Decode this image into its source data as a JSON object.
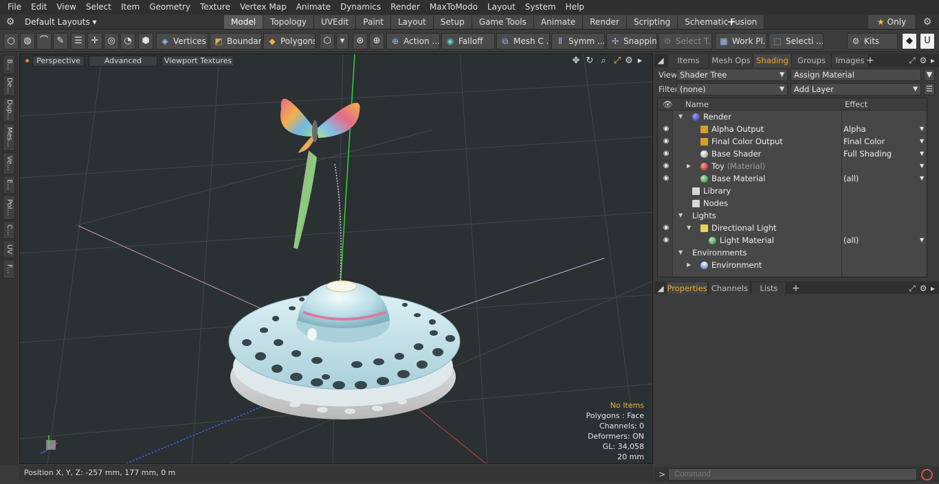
{
  "menu": [
    "File",
    "Edit",
    "View",
    "Select",
    "Item",
    "Geometry",
    "Texture",
    "Vertex Map",
    "Animate",
    "Dynamics",
    "Render",
    "MaxToModo",
    "Layout",
    "System",
    "Help"
  ],
  "layout_select": "Default Layouts ▾",
  "mode_tabs": [
    {
      "label": "Model",
      "active": true
    },
    {
      "label": "Topology"
    },
    {
      "label": "UVEdit"
    },
    {
      "label": "Paint"
    },
    {
      "label": "Layout"
    },
    {
      "label": "Setup"
    },
    {
      "label": "Game Tools"
    },
    {
      "label": "Animate"
    },
    {
      "label": "Render"
    },
    {
      "label": "Scripting"
    },
    {
      "label": "Schematic Fusion"
    }
  ],
  "add_tab": "+",
  "only_label": "Only",
  "toolbar": {
    "vertices": "Vertices",
    "boundary": "Boundary",
    "polygons": "Polygons",
    "action": "Action",
    "falloff": "Falloff",
    "mesh": "Mesh C ...",
    "symmetry": "Symm ...",
    "snapping": "Snapping",
    "select_t": "Select T...",
    "work_plane": "Work Pl...",
    "selection": "Selecti ...",
    "kits": "Kits"
  },
  "left_tabs": [
    "B...",
    "De...",
    "Dup...",
    "Mes...",
    "Ve...",
    "E...",
    "Pol...",
    "C...",
    "UV",
    "F..."
  ],
  "viewport": {
    "view_mode": "Perspective",
    "advanced": "Advanced",
    "textures": "Viewport Textures",
    "info": {
      "selection": "No Items",
      "polygons": "Polygons : Face",
      "channels": "Channels: 0",
      "deformers": "Deformers: ON",
      "gl": "GL: 34,058",
      "grid": "20 mm"
    }
  },
  "status": "Position X, Y, Z:   -257 mm, 177 mm, 0 m",
  "top_panel_tabs": [
    {
      "label": "Items"
    },
    {
      "label": "Mesh Ops"
    },
    {
      "label": "Shading",
      "active": true
    },
    {
      "label": "Groups"
    },
    {
      "label": "Images"
    }
  ],
  "shading": {
    "view_label": "View",
    "view_value": "Shader Tree",
    "assign_material": "Assign Material",
    "filter_label": "Filter",
    "filter_value": "(none)",
    "add_layer": "Add Layer",
    "col_name": "Name",
    "col_effect": "Effect",
    "rows": [
      {
        "name": "Render",
        "effect": "",
        "eye": false,
        "expand": "▼"
      },
      {
        "name": "Alpha Output",
        "effect": "Alpha",
        "eye": true
      },
      {
        "name": "Final Color Output",
        "effect": "Final Color",
        "eye": true
      },
      {
        "name": "Base Shader",
        "effect": "Full Shading",
        "eye": true
      },
      {
        "name": "Toy",
        "sub": "(Material)",
        "effect": "",
        "eye": true,
        "expand": "▶"
      },
      {
        "name": "Base Material",
        "effect": "(all)",
        "eye": true
      },
      {
        "name": "Library",
        "effect": "",
        "eye": false
      },
      {
        "name": "Nodes",
        "effect": "",
        "eye": false
      },
      {
        "name": "Lights",
        "effect": "",
        "eye": false,
        "expand": "▼"
      },
      {
        "name": "Directional Light",
        "effect": "",
        "eye": true,
        "expand": "▼"
      },
      {
        "name": "Light Material",
        "effect": "(all)",
        "eye": true
      },
      {
        "name": "Environments",
        "effect": "",
        "eye": false,
        "expand": "▼"
      },
      {
        "name": "Environment",
        "effect": "",
        "eye": false,
        "expand": "▶"
      }
    ]
  },
  "bottom_panel_tabs": [
    {
      "label": "Properties",
      "active": true
    },
    {
      "label": "Channels"
    },
    {
      "label": "Lists"
    }
  ],
  "command": {
    "prompt": ">",
    "placeholder": "Command"
  }
}
